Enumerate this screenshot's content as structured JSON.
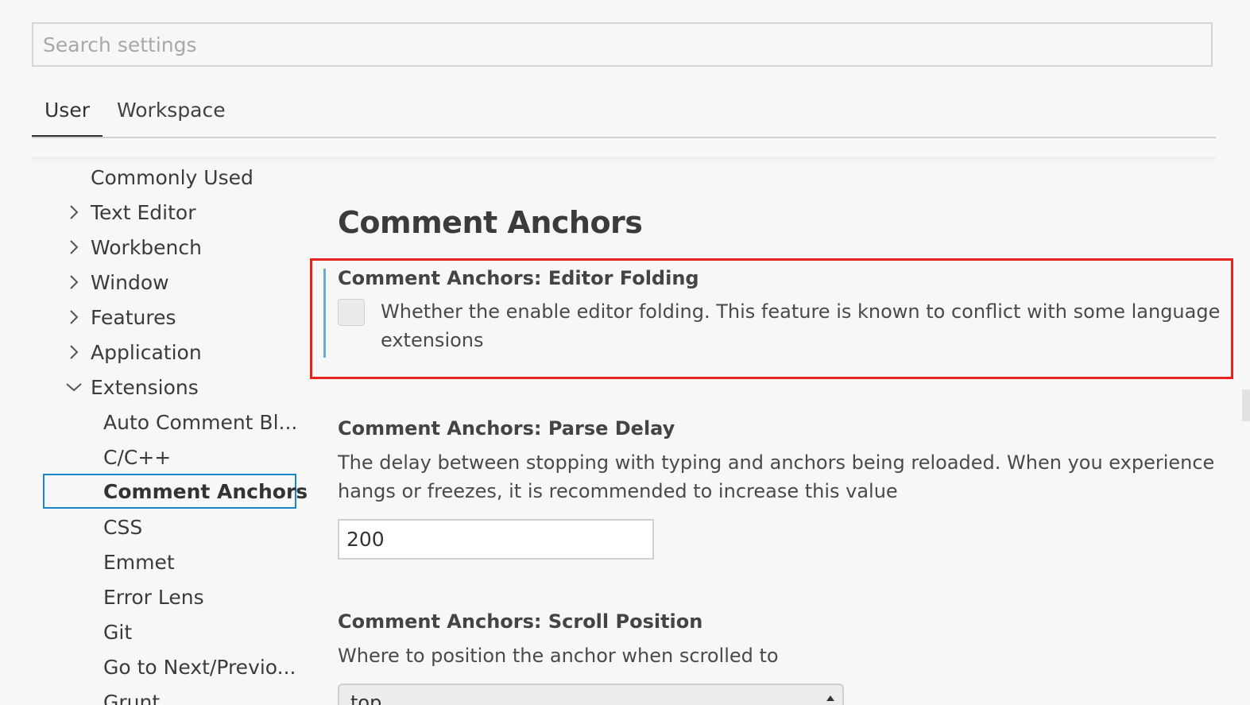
{
  "search": {
    "placeholder": "Search settings"
  },
  "tabs": [
    {
      "label": "User",
      "active": true
    },
    {
      "label": "Workspace",
      "active": false
    }
  ],
  "toc": {
    "items": [
      {
        "label": "Commonly Used",
        "expandable": false
      },
      {
        "label": "Text Editor",
        "expandable": true,
        "expanded": false
      },
      {
        "label": "Workbench",
        "expandable": true,
        "expanded": false
      },
      {
        "label": "Window",
        "expandable": true,
        "expanded": false
      },
      {
        "label": "Features",
        "expandable": true,
        "expanded": false
      },
      {
        "label": "Application",
        "expandable": true,
        "expanded": false
      },
      {
        "label": "Extensions",
        "expandable": true,
        "expanded": true
      }
    ],
    "children": [
      {
        "label": "Auto Comment Bl..."
      },
      {
        "label": "C/C++"
      },
      {
        "label": "Comment Anchors",
        "selected": true
      },
      {
        "label": "CSS"
      },
      {
        "label": "Emmet"
      },
      {
        "label": "Error Lens"
      },
      {
        "label": "Git"
      },
      {
        "label": "Go to Next/Previo..."
      },
      {
        "label": "Grunt"
      }
    ]
  },
  "content": {
    "section_title": "Comment Anchors",
    "settings": [
      {
        "title_prefix": "Comment Anchors: ",
        "title_name": "Editor Folding",
        "description_line1": "Whether the enable editor folding. This feature is known to conflict with some language",
        "description_line2": "extensions",
        "checked": false
      },
      {
        "title_prefix": "Comment Anchors: ",
        "title_name": "Parse Delay",
        "description_line1": "The delay between stopping with typing and anchors being reloaded. When you experience",
        "description_line2": "hangs or freezes, it is recommended to increase this value",
        "value": "200"
      },
      {
        "title_prefix": "Comment Anchors: ",
        "title_name": "Scroll Position",
        "description_line1": "Where to position the anchor when scrolled to",
        "value": "top"
      }
    ]
  },
  "colors": {
    "highlight_border": "#e8231d",
    "selection_border": "#1a85c9",
    "focus_bar": "#6fa8d8"
  },
  "icons": {
    "collapsed": "chevron-right-icon",
    "expanded": "chevron-down-icon",
    "select_arrow": "caret-up-down-icon"
  }
}
